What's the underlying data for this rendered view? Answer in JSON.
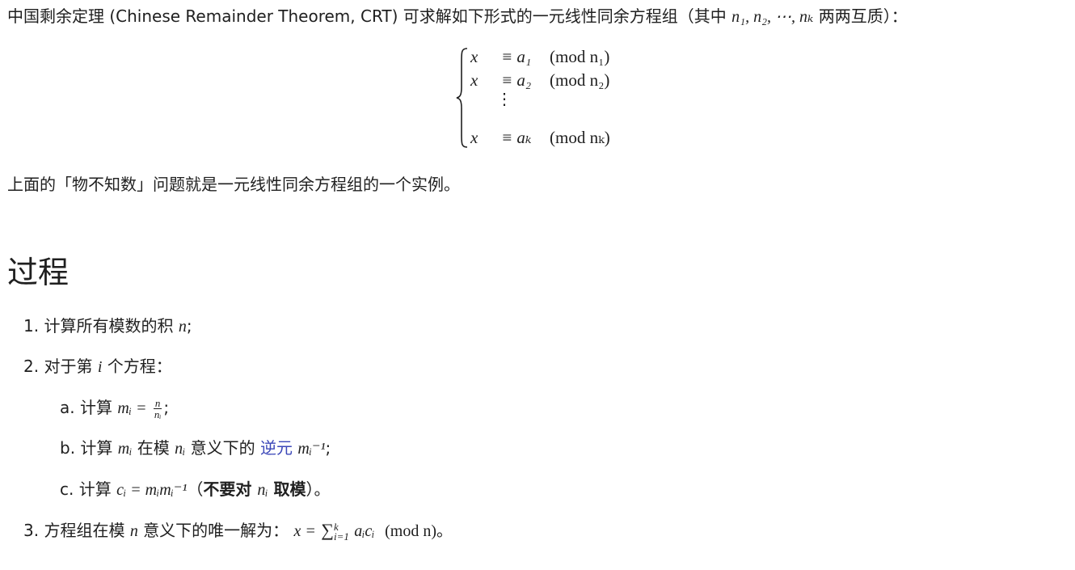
{
  "intro": {
    "text_before": "中国剩余定理 (Chinese Remainder Theorem, CRT) 可求解如下形式的一元线性同余方程组（其中 ",
    "vars": "n₁, n₂, ⋯, nₖ",
    "text_after": " 两两互质）："
  },
  "system": {
    "rows": [
      {
        "lhs": "x",
        "rel": "≡ a₁",
        "mod": "(mod  n₁)"
      },
      {
        "lhs": "x",
        "rel": "≡ a₂",
        "mod": "(mod  n₂)"
      },
      {
        "lhs": "x",
        "rel": "≡ aₖ",
        "mod": "(mod  nₖ)"
      }
    ],
    "dots": "⋮"
  },
  "example_text": "上面的「物不知数」问题就是一元线性同余方程组的一个实例。",
  "heading": "过程",
  "steps": {
    "s1": {
      "marker": "1.",
      "text": "计算所有模数的积 ",
      "math": "n",
      "tail": ";"
    },
    "s2": {
      "marker": "2.",
      "text": "对于第 ",
      "math": "i",
      "tail": " 个方程："
    },
    "s2a": {
      "marker": "a.",
      "text": "计算 ",
      "lhs": "mᵢ =",
      "num": "n",
      "den": "nᵢ",
      "tail": ";"
    },
    "s2b": {
      "marker": "b.",
      "text": "计算 ",
      "m1": "mᵢ",
      "mid": " 在模 ",
      "m2": "nᵢ",
      "mid2": " 意义下的 ",
      "link": "逆元",
      "m3": "mᵢ⁻¹",
      "tail": ";"
    },
    "s2c": {
      "marker": "c.",
      "text": "计算 ",
      "math": "cᵢ = mᵢmᵢ⁻¹",
      "paren_open": "（",
      "bold1": "不要对 ",
      "bold_math": "nᵢ",
      "bold2": " 取模",
      "paren_close": "）。"
    },
    "s3": {
      "marker": "3.",
      "text": "方程组在模 ",
      "m1": "n",
      "mid": " 意义下的唯一解为：",
      "x_eq": "x =",
      "sum": "∑",
      "sum_upper": "k",
      "sum_lower": "i=1",
      "term": "aᵢcᵢ",
      "mod": "(mod  n)",
      "tail": "。"
    }
  }
}
